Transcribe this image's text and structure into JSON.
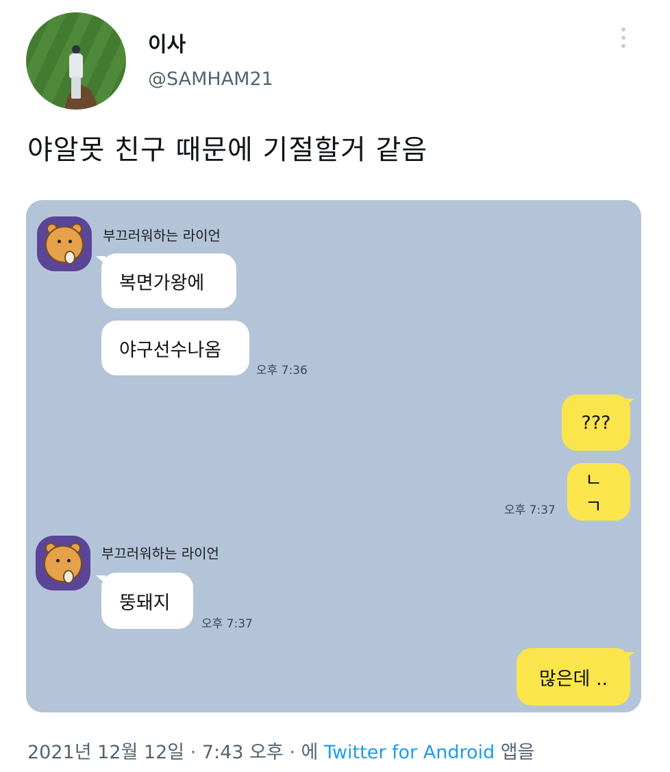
{
  "tweet": {
    "display_name": "이사",
    "handle": "@SAMHAM21",
    "text": "야알못 친구 때문에 기절할거 같음",
    "footer": {
      "date": "2021년 12월 12일",
      "separator1": " · ",
      "time": "7:43 오후",
      "separator2": " · 에 ",
      "source": "Twitter for Android",
      "suffix": " 앱을"
    }
  },
  "chat": {
    "sender_name_1": "부끄러워하는 라이언",
    "msg_1": "복면가왕에",
    "msg_2": "야구선수나옴",
    "time_1": "오후 7:36",
    "reply_1": "???",
    "reply_2": "ㄴㄱ",
    "time_2": "오후 7:37",
    "sender_name_2": "부끄러워하는 라이언",
    "msg_3": "뚱돼지",
    "time_3": "오후 7:37",
    "reply_3": "많은데 .."
  },
  "colors": {
    "chat_background": "#b3c4d8",
    "outgoing_bubble": "#fbe54d",
    "incoming_bubble": "#ffffff",
    "link": "#1d9bf0"
  }
}
